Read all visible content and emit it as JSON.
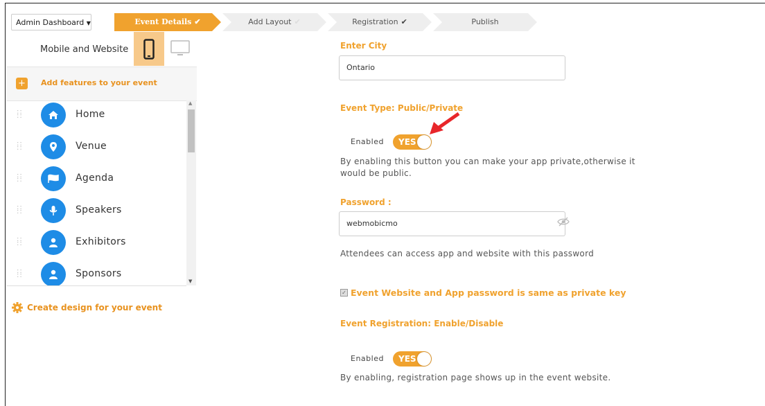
{
  "header": {
    "admin_dropdown": "Admin Dashboard",
    "steps": [
      {
        "label": "Event Details",
        "state": "active"
      },
      {
        "label": "Add Layout",
        "state": "done-faded"
      },
      {
        "label": "Registration",
        "state": "done"
      },
      {
        "label": "Publish",
        "state": "pending"
      }
    ]
  },
  "sidebar": {
    "mode_label": "Mobile and Website",
    "add_features": "Add features to your event",
    "features": [
      {
        "label": "Home",
        "icon": "home-icon"
      },
      {
        "label": "Venue",
        "icon": "map-pin-icon"
      },
      {
        "label": "Agenda",
        "icon": "flag-icon"
      },
      {
        "label": "Speakers",
        "icon": "microphone-icon"
      },
      {
        "label": "Exhibitors",
        "icon": "user-icon"
      },
      {
        "label": "Sponsors",
        "icon": "user-icon"
      }
    ],
    "create_design": "Create design for your event"
  },
  "form": {
    "city_label": "Enter City",
    "city_value": "Ontario",
    "event_type_label": "Event Type: Public/Private",
    "event_type_enabled_label": "Enabled",
    "event_type_toggle": "YES",
    "event_type_help": "By enabling this button you can make your app private,otherwise it would be public.",
    "password_label": "Password :",
    "password_value": "webmobicmo",
    "password_help": "Attendees can access app and website with this password",
    "same_key_label": "Event Website and App password is same as private key",
    "registration_label": "Event Registration: Enable/Disable",
    "registration_enabled_label": "Enabled",
    "registration_toggle": "YES",
    "registration_help": "By enabling, registration page shows up in the event website."
  },
  "colors": {
    "accent": "#f0a22e",
    "icon_blue": "#1e8ce6",
    "arrow": "#e8262a"
  }
}
